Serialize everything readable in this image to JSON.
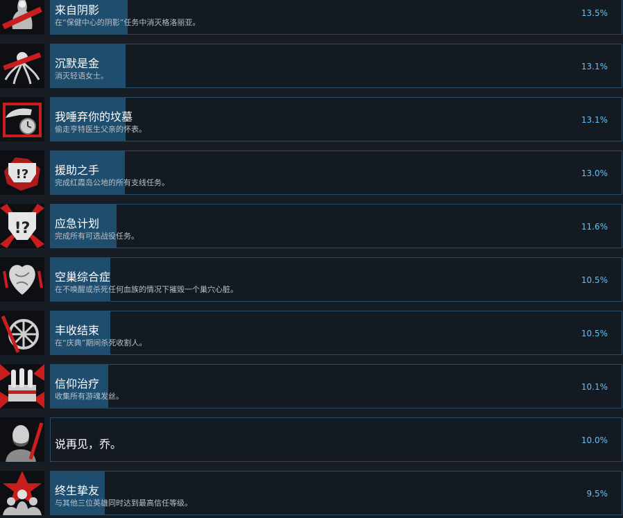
{
  "colors": {
    "background": "#171d25",
    "progress_fill": "#1e4d6d",
    "panel_border": "#2a4a66",
    "percent_text": "#66c0f4",
    "icon_accent": "#c81e1e"
  },
  "achievements": [
    {
      "icon": "shadow-figure-icon",
      "title": "来自阴影",
      "desc": "在“保健中心的阴影”任务中消灭格洛丽亚。",
      "percent_text": "13.5%",
      "percent": 13.5
    },
    {
      "icon": "tentacle-creature-icon",
      "title": "沉默是金",
      "desc": "消灭轻语女士。",
      "percent_text": "13.1%",
      "percent": 13.1
    },
    {
      "icon": "hand-pocket-watch-icon",
      "title": "我唾弃你的坟墓",
      "desc": "偷走亨特医生父亲的怀表。",
      "percent_text": "13.1%",
      "percent": 13.1
    },
    {
      "icon": "helping-hand-badge-icon",
      "title": "援助之手",
      "desc": "完成红霞岛公地的所有支线任务。",
      "percent_text": "13.0%",
      "percent": 13.0
    },
    {
      "icon": "contingency-badge-icon",
      "title": "应急计划",
      "desc": "完成所有可选战役任务。",
      "percent_text": "11.6%",
      "percent": 11.6
    },
    {
      "icon": "nest-heart-icon",
      "title": "空巢综合症",
      "desc": "在不唤醒或杀死任何血族的情况下摧毁一个巢穴心脏。",
      "percent_text": "10.5%",
      "percent": 10.5
    },
    {
      "icon": "harvest-wheel-icon",
      "title": "丰收结束",
      "desc": "在“庆典”期间杀死收割人。",
      "percent_text": "10.5%",
      "percent": 10.5
    },
    {
      "icon": "vials-box-icon",
      "title": "信仰治疗",
      "desc": "收集所有游魂发丝。",
      "percent_text": "10.1%",
      "percent": 10.1
    },
    {
      "icon": "bearded-man-portrait-icon",
      "title": "说再见，乔。",
      "desc": "",
      "percent_text": "10.0%",
      "percent": 10.0
    },
    {
      "icon": "star-group-icon",
      "title": "终生挚友",
      "desc": "与其他三位英雄同时达到最高信任等级。",
      "percent_text": "9.5%",
      "percent": 9.5
    }
  ]
}
